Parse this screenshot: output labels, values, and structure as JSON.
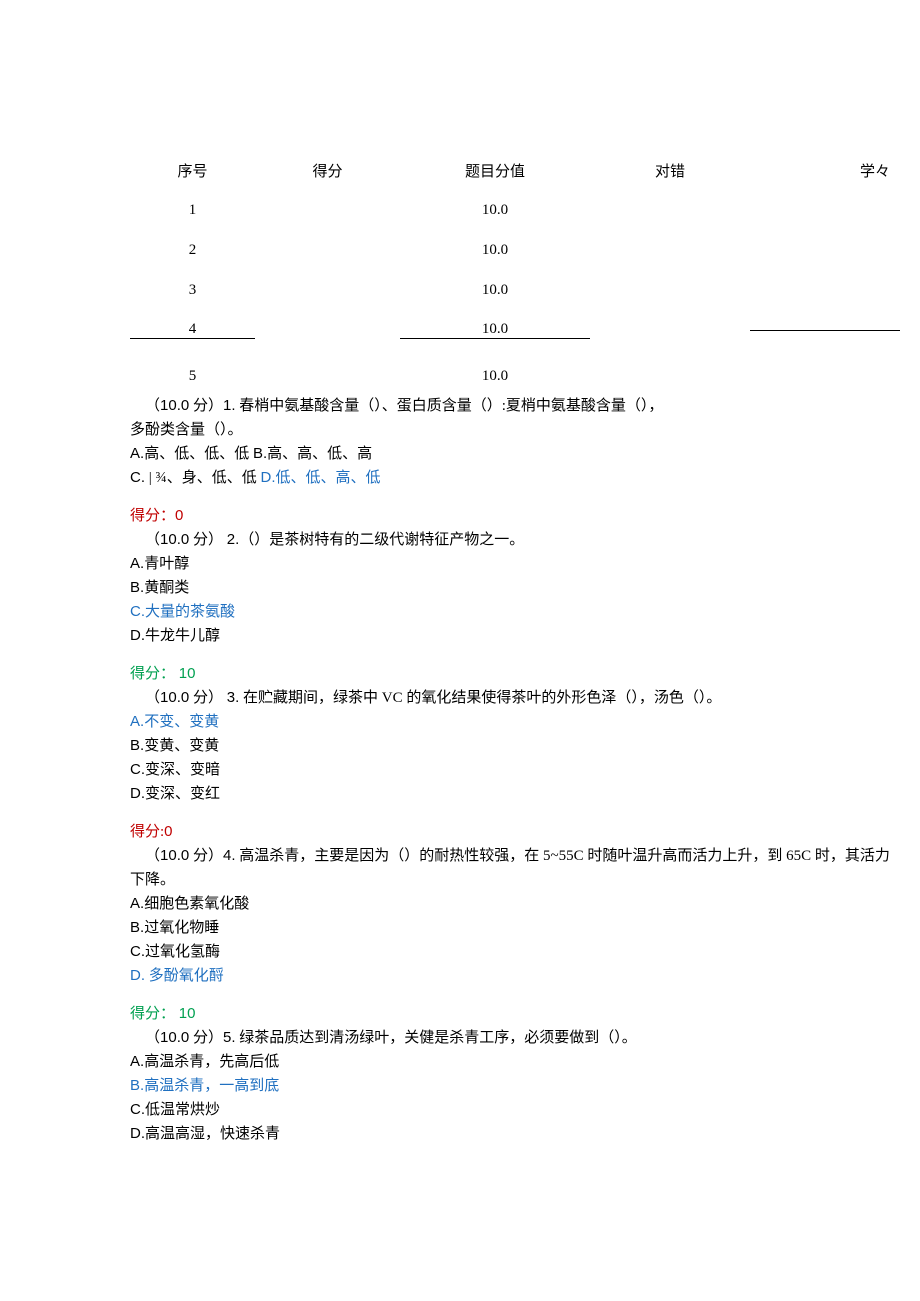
{
  "table": {
    "headers": {
      "seq": "序号",
      "score": "得分",
      "value": "题目分值",
      "right": "对错",
      "xue": "学々"
    },
    "rows": [
      {
        "seq": "1",
        "value": "10.0"
      },
      {
        "seq": "2",
        "value": "10.0"
      },
      {
        "seq": "3",
        "value": "10.0"
      },
      {
        "seq": "4",
        "value": "10.0"
      },
      {
        "seq": "5",
        "value": "10.0"
      }
    ]
  },
  "q1": {
    "prompt_a": "（",
    "pts": "10.0",
    "prompt_b": " 分）",
    "num": "1.",
    "text_a": " 春梢中氨基酸含量（）、蛋白质含量（）:夏梢中氨基酸含量（），",
    "text_b": "多酚类含量（）。",
    "opt_a": "A.",
    "opt_a_txt": "高、低、低、低 ",
    "opt_b": "B.",
    "opt_b_txt": "高、高、低、高",
    "opt_c": "C.",
    "opt_c_txt": " | ¾、身、低、低 ",
    "opt_d": "D.",
    "opt_d_txt": "低、低、高、低",
    "score_label": "得分：",
    "score_val": "0"
  },
  "q2": {
    "prompt_a": "（",
    "pts": "10.0",
    "prompt_b": " 分） ",
    "num": "2.",
    "text": "（）是茶树特有的二级代谢特征产物之一。",
    "a": "A.",
    "a_txt": "青叶醇",
    "b": "B.",
    "b_txt": "黄酮类",
    "c": "C.",
    "c_txt": "大量的茶氨酸",
    "d": "D.",
    "d_txt": "牛龙牛儿醇",
    "score_label": "得分： ",
    "score_val": "10"
  },
  "q3": {
    "prompt_a": "（",
    "pts": "10.0",
    "prompt_b": " 分） ",
    "num": "3.",
    "text": " 在贮藏期间，绿茶中 VC 的氧化结果使得茶叶的外形色泽（），汤色（）。",
    "a": "A.",
    "a_txt": "不变、变黄",
    "b": "B.",
    "b_txt": "变黄、变黄",
    "c": "C.",
    "c_txt": "变深、变暗",
    "d": "D.",
    "d_txt": "变深、变红",
    "score_label": "得分:",
    "score_val": "0"
  },
  "q4": {
    "prompt_a": "（",
    "pts": "10.0",
    "prompt_b": " 分）",
    "num": "4.",
    "text": " 高温杀青，主要是因为（）的耐热性较强，在 5~55C 时随叶温升高而活力上升，到 65C 时，其活力下降。",
    "a": "A.",
    "a_txt": "细胞色素氧化酸",
    "b": "B.",
    "b_txt": "过氧化物睡",
    "c": "C.",
    "c_txt": "过氧化氢酶",
    "d": "D.",
    "d_txt": " 多酚氧化酹",
    "score_label": "得分： ",
    "score_val": "10"
  },
  "q5": {
    "prompt_a": "（",
    "pts": "10.0",
    "prompt_b": " 分）",
    "num": "5.",
    "text": " 绿茶品质达到清汤绿叶，关健是杀青工序，必须要做到（）。",
    "a": "A.",
    "a_txt": "高温杀青，先高后低",
    "b": "B.",
    "b_txt": "高温杀青，一高到底",
    "c": "C.",
    "c_txt": "低温常烘炒",
    "d": "D.",
    "d_txt": "高温高湿，快速杀青"
  }
}
